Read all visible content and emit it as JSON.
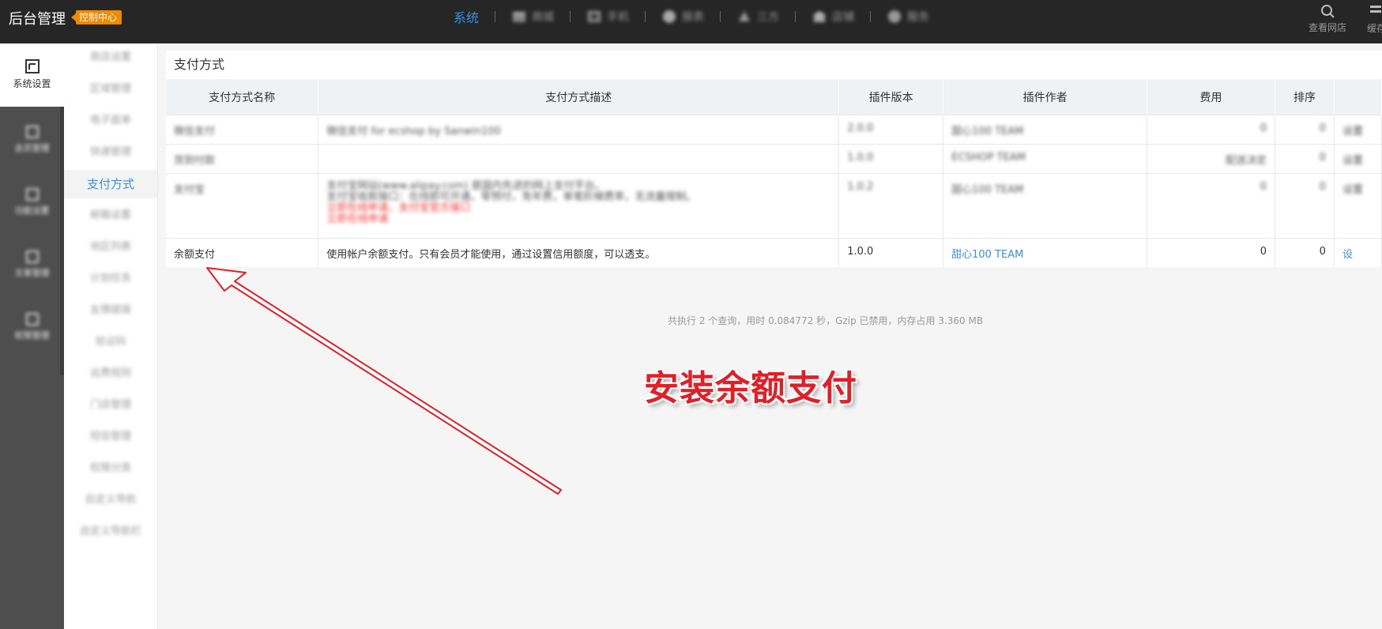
{
  "topbar": {
    "brand": "后台管理",
    "brand_badge": "控制中心",
    "nav": [
      {
        "label": "系统",
        "icon": "",
        "active": true
      },
      {
        "label": "商城",
        "icon": "shop-icon"
      },
      {
        "label": "手机",
        "icon": "mobile-icon"
      },
      {
        "label": "报表",
        "icon": "report-icon"
      },
      {
        "label": "三方",
        "icon": "sitemap-icon"
      },
      {
        "label": "店铺",
        "icon": "store-icon"
      },
      {
        "label": "服务",
        "icon": "cloud-icon"
      }
    ],
    "view_site": "查看网店",
    "cache_label": "缓存"
  },
  "rail": {
    "active_label": "系统设置",
    "items": [
      "会员管理",
      "功能设置",
      "文章管理",
      "权限管理"
    ]
  },
  "subnav": {
    "items": [
      {
        "label": "商店设置"
      },
      {
        "label": "区域管理"
      },
      {
        "label": "电子面单"
      },
      {
        "label": "快递管理"
      },
      {
        "label": "支付方式",
        "active": true
      },
      {
        "label": "邮箱设置"
      },
      {
        "label": "地区列表"
      },
      {
        "label": "计划任务"
      },
      {
        "label": "友情链接"
      },
      {
        "label": "验证码"
      },
      {
        "label": "运费规则"
      },
      {
        "label": "门店管理"
      },
      {
        "label": "短信管理"
      },
      {
        "label": "权限分类"
      },
      {
        "label": "自定义导航"
      },
      {
        "label": "自定义导航栏"
      }
    ]
  },
  "panel": {
    "title": "支付方式",
    "headers": [
      "支付方式名称",
      "支付方式描述",
      "插件版本",
      "插件作者",
      "费用",
      "排序",
      ""
    ],
    "rows": [
      {
        "name": "微信支付",
        "desc": "微信支付 for ecshop by Sanwin100",
        "version": "2.0.0",
        "author": "甜心100 TEAM",
        "fee": "0",
        "order": "0",
        "op": "设置"
      },
      {
        "name": "货到付款",
        "desc": "",
        "version": "1.0.0",
        "author": "ECSHOP TEAM",
        "fee": "配送决定",
        "order": "0",
        "op": "设置"
      },
      {
        "name": "支付宝",
        "desc": "支付宝网站(www.alipay.com) 是国内先进的网上支付平台。",
        "desc2": "支付宝收款接口：在线即可开通，零预付，免年费，单笔阶梯费率，无流量限制。",
        "desc3": "立即在线申请，支付宝官方接口",
        "desc4": "立即在线申请",
        "version": "1.0.2",
        "author": "甜心100 TEAM",
        "fee": "0",
        "order": "0",
        "op": "设置"
      },
      {
        "name": "余额支付",
        "desc": "使用帐户余额支付。只有会员才能使用，通过设置信用额度，可以透支。",
        "version": "1.0.0",
        "author": "甜心100 TEAM",
        "fee": "0",
        "order": "0",
        "op": "设"
      }
    ]
  },
  "footer_stats": "共执行 2 个查询，用时 0.084772 秒，Gzip 已禁用，内存占用 3.360 MB",
  "annotation": "安装余额支付",
  "colors": {
    "accent": "#3c8fe0",
    "badge": "#f08a00",
    "annotation": "#e21e26",
    "topbar": "#262626"
  }
}
